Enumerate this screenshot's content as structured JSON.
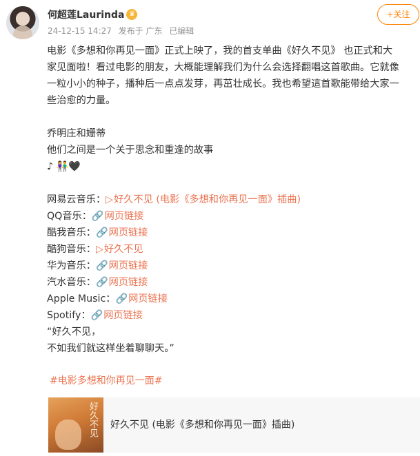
{
  "header": {
    "username": "何超莲Laurinda",
    "verified_icon": "crown-badge-icon",
    "timestamp": "24-12-15 14:27",
    "source": "发布于 广东",
    "edited": "已编辑",
    "follow_label": "+关注"
  },
  "post": {
    "paragraph_lines": [
      "电影《多想和你再见一面》正式上映了，我的首支单曲《好久不见》 也正式和大",
      "家见面啦！看过电影的朋友，大概能理解我们为什么会选择翻唱这首歌曲。它就像",
      "一粒小小的种子，播种后一点点发芽，再茁壮成长。我也希望這首歌能带给大家一",
      "些治愈的力量。"
    ],
    "names_line": "乔明庄和姗蒂",
    "story_line": "他们之间是一个关于思念和重逢的故事",
    "emoji_line": "♪ 👫🖤",
    "music_links": [
      {
        "platform": "网易云音乐：",
        "icon": "play-icon",
        "icon_glyph": "▷",
        "link_text": "好久不见 (电影《多想和你再见一面》插曲)"
      },
      {
        "platform": "QQ音乐：",
        "icon": "link-icon",
        "icon_glyph": "🔗",
        "link_text": "网页链接"
      },
      {
        "platform": "酷我音乐：",
        "icon": "link-icon",
        "icon_glyph": "🔗",
        "link_text": "网页链接"
      },
      {
        "platform": "酷狗音乐：",
        "icon": "play-icon",
        "icon_glyph": "▷",
        "link_text": "好久不见"
      },
      {
        "platform": "华为音乐：",
        "icon": "link-icon",
        "icon_glyph": "🔗",
        "link_text": "网页链接"
      },
      {
        "platform": "汽水音乐：",
        "icon": "link-icon",
        "icon_glyph": "🔗",
        "link_text": "网页链接"
      },
      {
        "platform": "Apple Music：",
        "icon": "link-icon",
        "icon_glyph": "🔗",
        "link_text": "网页链接"
      },
      {
        "platform": "Spotify：",
        "icon": "link-icon",
        "icon_glyph": "🔗",
        "link_text": "网页链接"
      }
    ],
    "quote_line_1": " “好久不见，",
    "quote_line_2": "不如我们就这样坐着聊聊天。”"
  },
  "topic": "#电影多想和你再见一面#",
  "card": {
    "thumb_text": "好久不见",
    "title": "好久不见 (电影《多想和你再见一面》插曲)"
  },
  "colors": {
    "link": "#eb7350",
    "follow": "#ff8200",
    "meta": "#939393"
  }
}
